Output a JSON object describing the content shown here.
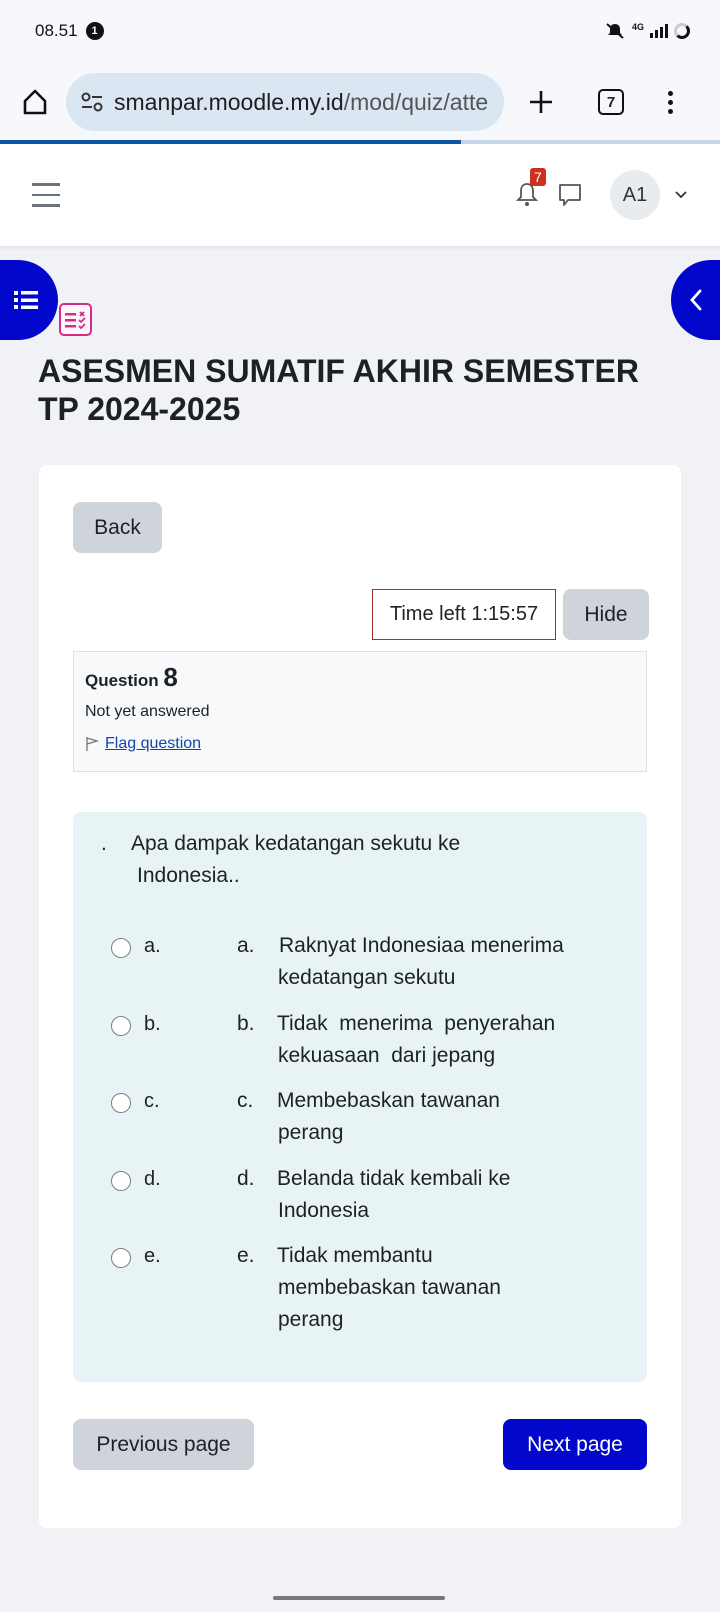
{
  "status_bar": {
    "time": "08.51",
    "notification_count": "1",
    "network": "4G"
  },
  "browser": {
    "url_domain": "smanpar.moodle.my.id",
    "url_path": "/mod/quiz/atte",
    "tab_count": "7",
    "load_progress": 0.64
  },
  "navbar": {
    "notification_badge": "7",
    "avatar_initials": "A1"
  },
  "page": {
    "title": "ASESMEN SUMATIF AKHIR SEMESTER TP 2024-2025"
  },
  "quiz": {
    "back_label": "Back",
    "timer_label": "Time left 1:15:57",
    "hide_label": "Hide",
    "question_label": "Question",
    "question_number": "8",
    "question_state": "Not yet answered",
    "flag_label": "Flag question",
    "question_prefix": ".",
    "question_text_line1": "Apa dampak  kedatangan sekutu ke",
    "question_text_line2": "Indonesia..",
    "answers": [
      {
        "letter": "a.",
        "prefix": "a.",
        "line1": "Raknyat Indonesiaa menerima",
        "rest": "kedatangan sekutu"
      },
      {
        "letter": "b.",
        "prefix": "b.",
        "line1": "Tidak  menerima  penyerahan",
        "rest": "kekuasaan  dari jepang"
      },
      {
        "letter": "c.",
        "prefix": "c.",
        "line1": "Membebaskan tawanan",
        "rest": "perang"
      },
      {
        "letter": "d.",
        "prefix": "d.",
        "line1": "Belanda tidak kembali ke",
        "rest": "Indonesia"
      },
      {
        "letter": "e.",
        "prefix": "e.",
        "line1": "Tidak membantu",
        "rest": "membebaskan tawanan perang"
      }
    ],
    "prev_label": "Previous page",
    "next_label": "Next page"
  },
  "colors": {
    "primary": "#0107cb",
    "question_bg": "#e7f3f5",
    "timer_border": "#a2312f",
    "badge": "#ca3120",
    "quiz_icon": "#d12d8b"
  }
}
